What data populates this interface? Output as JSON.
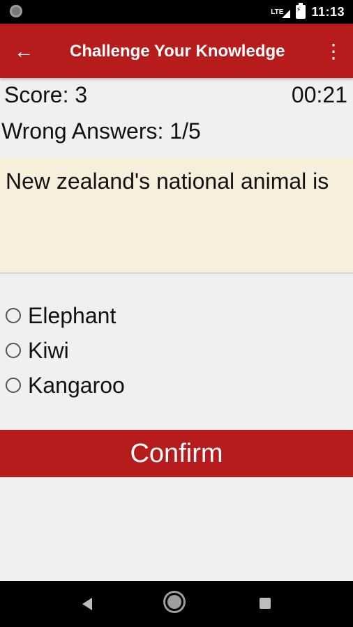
{
  "status_bar": {
    "network": "LTE",
    "time": "11:13"
  },
  "app_bar": {
    "back_icon": "arrow-back-icon",
    "title": "Challenge Your Knowledge",
    "menu_icon": "more-vert-icon"
  },
  "quiz": {
    "score": "Score: 3",
    "timer": "00:21",
    "wrong_answers": "Wrong Answers: 1/5",
    "question": "New zealand's national animal is",
    "options": [
      {
        "label": "Elephant",
        "selected": false
      },
      {
        "label": "Kiwi",
        "selected": false
      },
      {
        "label": "Kangaroo",
        "selected": false
      }
    ],
    "confirm_label": "Confirm"
  },
  "colors": {
    "primary": "#b71c1c",
    "question_bg": "#f7eedb",
    "background": "#f0f0f0"
  }
}
